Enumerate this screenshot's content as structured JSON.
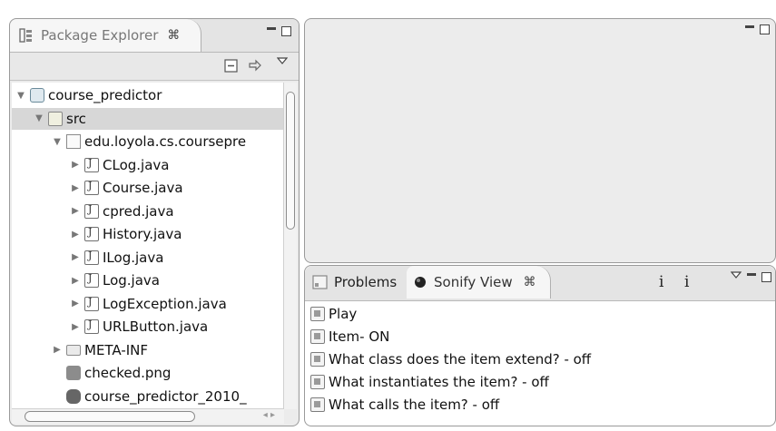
{
  "package_explorer": {
    "tab_label": "Package Explorer",
    "close_glyph": "⌘",
    "tree": [
      {
        "label": "course_predictor",
        "arrow": "▼",
        "icon": "project-icon",
        "level": 0
      },
      {
        "label": "src",
        "arrow": "▼",
        "icon": "source-folder-icon",
        "level": 1,
        "selected": true
      },
      {
        "label": "edu.loyola.cs.coursepre",
        "arrow": "▼",
        "icon": "package-icon",
        "level": 2
      },
      {
        "label": "CLog.java",
        "arrow": "▶",
        "icon": "java-file-icon",
        "level": 3
      },
      {
        "label": "Course.java",
        "arrow": "▶",
        "icon": "java-file-icon",
        "level": 3
      },
      {
        "label": "cpred.java",
        "arrow": "▶",
        "icon": "java-file-icon",
        "level": 3
      },
      {
        "label": "History.java",
        "arrow": "▶",
        "icon": "java-file-icon",
        "level": 3
      },
      {
        "label": "ILog.java",
        "arrow": "▶",
        "icon": "java-file-icon",
        "level": 3
      },
      {
        "label": "Log.java",
        "arrow": "▶",
        "icon": "java-file-icon",
        "level": 3
      },
      {
        "label": "LogException.java",
        "arrow": "▶",
        "icon": "java-file-icon",
        "level": 3
      },
      {
        "label": "URLButton.java",
        "arrow": "▶",
        "icon": "java-file-icon",
        "level": 3
      },
      {
        "label": "META-INF",
        "arrow": "▶",
        "icon": "folder-icon",
        "level": 2
      },
      {
        "label": "checked.png",
        "arrow": "",
        "icon": "image-file-icon",
        "level": 2
      },
      {
        "label": "course_predictor_2010_",
        "arrow": "",
        "icon": "jar-file-icon",
        "level": 2
      }
    ]
  },
  "bottom_view": {
    "tabs": [
      {
        "label": "Problems",
        "active": false
      },
      {
        "label": "Sonify View",
        "active": true
      }
    ],
    "close_glyph": "⌘",
    "info_glyphs": [
      "i",
      "i"
    ],
    "items": [
      "Play",
      "Item- ON",
      "What class does the item extend? - off",
      "What instantiates the item? - off",
      "What calls the item? - off"
    ]
  }
}
